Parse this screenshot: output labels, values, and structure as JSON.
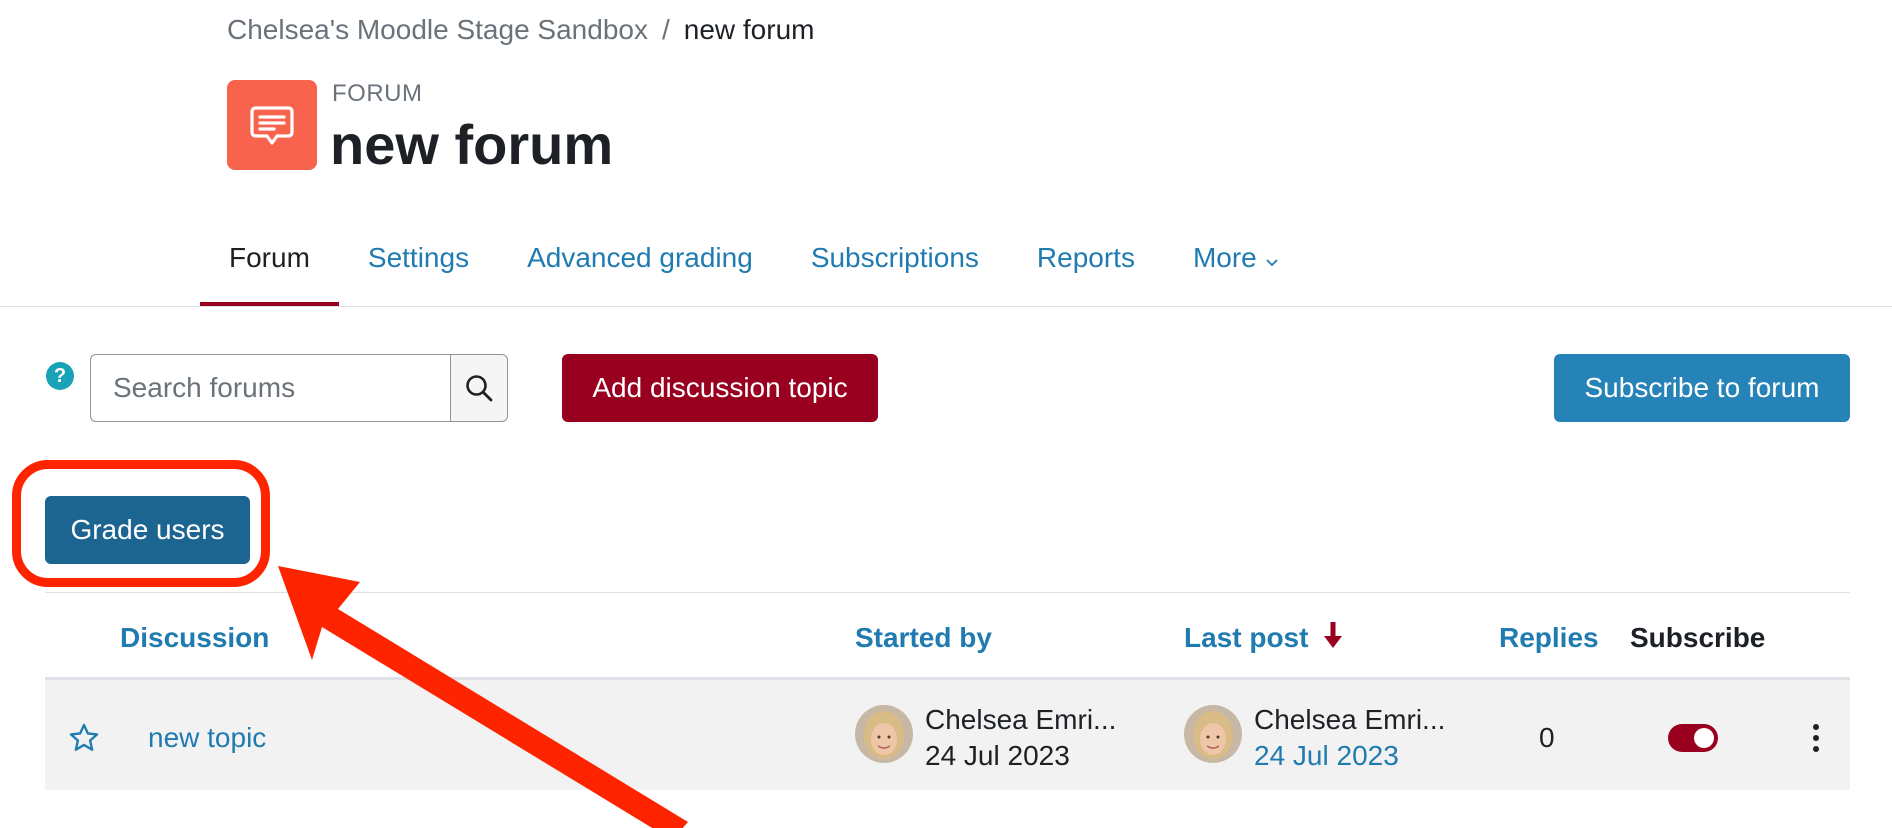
{
  "breadcrumb": {
    "course": "Chelsea's Moodle Stage Sandbox",
    "separator": "/",
    "current": "new forum"
  },
  "header": {
    "module_type": "FORUM",
    "title": "new forum",
    "icon": "forum-chat-icon",
    "icon_color": "#f7634d"
  },
  "tabs": [
    {
      "label": "Forum",
      "active": true
    },
    {
      "label": "Settings",
      "active": false
    },
    {
      "label": "Advanced grading",
      "active": false
    },
    {
      "label": "Subscriptions",
      "active": false
    },
    {
      "label": "Reports",
      "active": false
    },
    {
      "label": "More",
      "active": false
    }
  ],
  "toolbar": {
    "help_icon": "?",
    "search_placeholder": "Search forums",
    "add_discussion_label": "Add discussion topic",
    "subscribe_forum_label": "Subscribe to forum",
    "grade_users_label": "Grade users"
  },
  "table": {
    "headers": {
      "discussion": "Discussion",
      "started_by": "Started by",
      "last_post": "Last post",
      "replies": "Replies",
      "subscribe": "Subscribe"
    },
    "sort": {
      "column": "last_post",
      "direction": "descending"
    },
    "rows": [
      {
        "title": "new topic",
        "starred": false,
        "started_by_name": "Chelsea Emri...",
        "started_date": "24 Jul 2023",
        "last_post_name": "Chelsea Emri...",
        "last_post_date": "24 Jul 2023",
        "replies": "0",
        "subscribed": true
      }
    ]
  },
  "colors": {
    "primary_red": "#99001f",
    "link_blue": "#1f7bb0",
    "subscribe_blue": "#2683b8",
    "grade_blue": "#1c6591",
    "annotation_red": "#ff2400"
  }
}
